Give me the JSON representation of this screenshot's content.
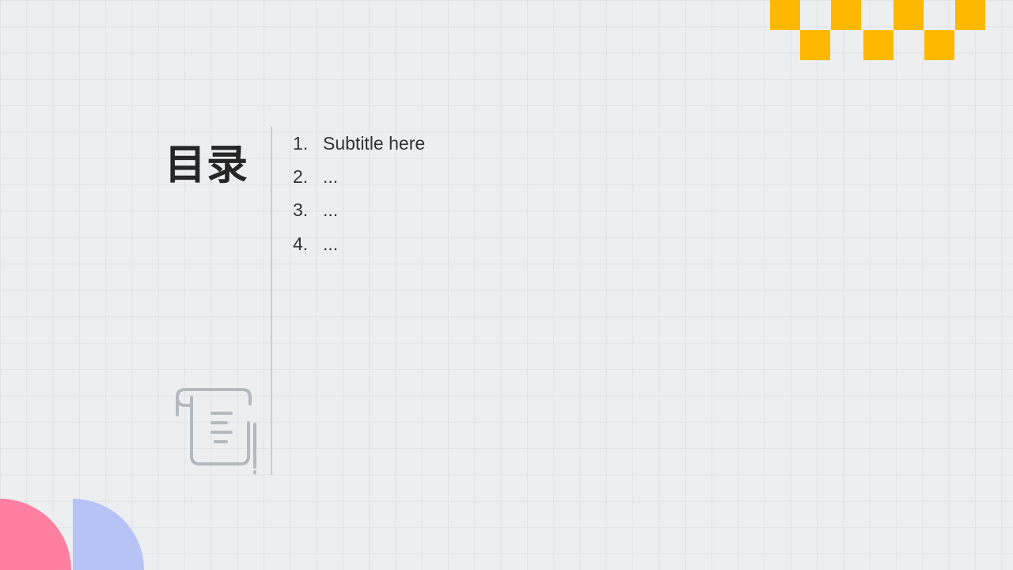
{
  "title": "目录",
  "toc": [
    {
      "num": "1.",
      "text": "Subtitle here"
    },
    {
      "num": "2.",
      "text": "..."
    },
    {
      "num": "3.",
      "text": "..."
    },
    {
      "num": "4.",
      "text": "..."
    }
  ],
  "colors": {
    "accent_yellow": "#ffb800",
    "accent_pink": "#ff7fa0",
    "accent_lavender": "#b7c3f5",
    "icon_gray": "#b3b9bf"
  },
  "icons": {
    "scroll": "scroll-document-icon"
  }
}
